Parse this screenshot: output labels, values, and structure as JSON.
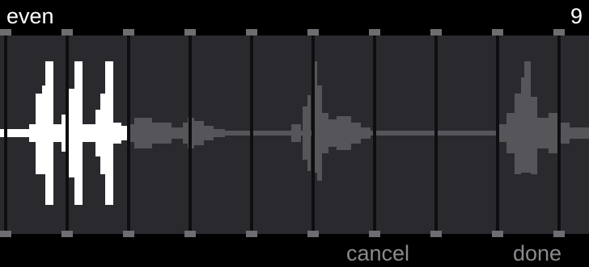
{
  "header": {
    "mode_label": "even",
    "count": "9"
  },
  "footer": {
    "cancel_label": "cancel",
    "done_label": "done"
  },
  "slices": {
    "count": 9,
    "selected_count": 2
  },
  "colors": {
    "background": "#000000",
    "panel": "#2a2a2e",
    "divider": "#0e0e10",
    "handle": "#6e6e72",
    "wave_active": "#ffffff",
    "wave_inactive": "#55555a",
    "button_text": "#8a8a8e"
  }
}
